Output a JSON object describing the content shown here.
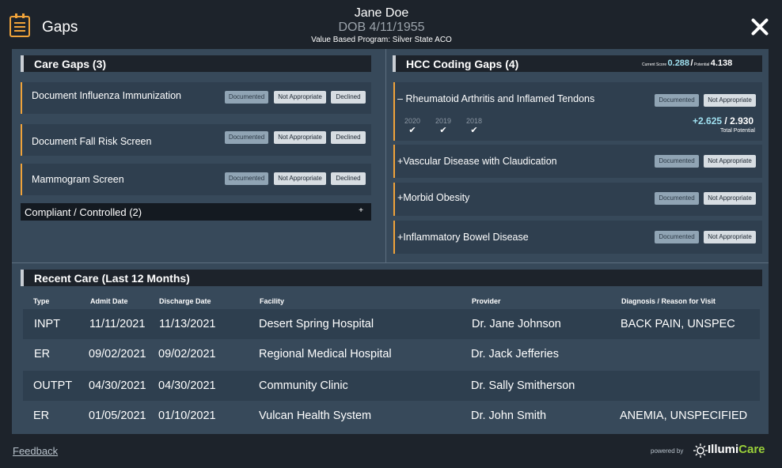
{
  "header": {
    "title": "Gaps",
    "patient_name": "Jane Doe",
    "patient_dob": "DOB 4/11/1955",
    "program": "Value Based Program:  Silver State ACO"
  },
  "care_gaps": {
    "title": "Care Gaps (3)",
    "items": [
      {
        "label": "Document Influenza Immunization",
        "documented": "Documented",
        "not_appropriate": "Not Appropriate",
        "declined": "Declined"
      },
      {
        "label": "Document Fall Risk Screen",
        "documented": "Documented",
        "not_appropriate": "Not Appropriate",
        "declined": "Declined"
      },
      {
        "label": "Mammogram Screen",
        "documented": "Documented",
        "not_appropriate": "Not Appropriate",
        "declined": "Declined"
      }
    ],
    "compliant_label": "Compliant / Controlled (2)",
    "compliant_toggle": "+"
  },
  "hcc": {
    "title": "HCC Coding Gaps (4)",
    "current_score_label": "Current Score",
    "current_score": "0.288",
    "separator": "/",
    "potential_label": "Potential",
    "potential_score": "4.138",
    "items": [
      {
        "toggle": "–",
        "label": "Rheumatoid Arthritis and Inflamed Tendons",
        "documented": "Documented",
        "not_appropriate": "Not Appropriate",
        "expanded": true
      },
      {
        "toggle": "+",
        "label": "Vascular Disease with Claudication",
        "documented": "Documented",
        "not_appropriate": "Not Appropriate"
      },
      {
        "toggle": "+",
        "label": "Morbid Obesity",
        "documented": "Documented",
        "not_appropriate": "Not Appropriate"
      },
      {
        "toggle": "+",
        "label": "Inflammatory Bowel Disease",
        "documented": "Documented",
        "not_appropriate": "Not Appropriate"
      }
    ],
    "detail": {
      "years": [
        "2020",
        "2019",
        "2018"
      ],
      "check": "✔",
      "score_increase": "+2.625",
      "score_total": "2.930",
      "total_label": "Total Potential"
    }
  },
  "recent_care": {
    "title": "Recent Care (Last 12 Months)",
    "columns": [
      "Type",
      "Admit Date",
      "Discharge Date",
      "Facility",
      "Provider",
      "Diagnosis / Reason for Visit"
    ],
    "rows": [
      [
        "INPT",
        "11/11/2021",
        "11/13/2021",
        "Desert Spring Hospital",
        "Dr. Jane Johnson",
        "BACK PAIN, UNSPEC"
      ],
      [
        "ER",
        "09/02/2021",
        "09/02/2021",
        "Regional Medical Hospital",
        "Dr. Jack Jefferies",
        ""
      ],
      [
        "OUTPT",
        "04/30/2021",
        "04/30/2021",
        "Community Clinic",
        "Dr. Sally Smitherson",
        ""
      ],
      [
        "ER",
        "01/05/2021",
        "01/10/2021",
        "Vulcan Health System",
        "Dr. John Smith",
        "ANEMIA, UNSPECIFIED"
      ]
    ]
  },
  "footer": {
    "feedback": "Feedback",
    "powered_by": "powered by",
    "logo_part1": "Illumi",
    "logo_part2": "Care"
  },
  "colors": {
    "accent": "#f0a33a",
    "panel": "#37495a",
    "background": "#1d232b",
    "score_highlight": "#9fe0f0",
    "logo_green": "#9bd13a"
  },
  "icons": {
    "app": "calendar-list-icon",
    "close": "close-icon",
    "check": "checkmark-icon",
    "logo": "sun-logo-icon"
  }
}
